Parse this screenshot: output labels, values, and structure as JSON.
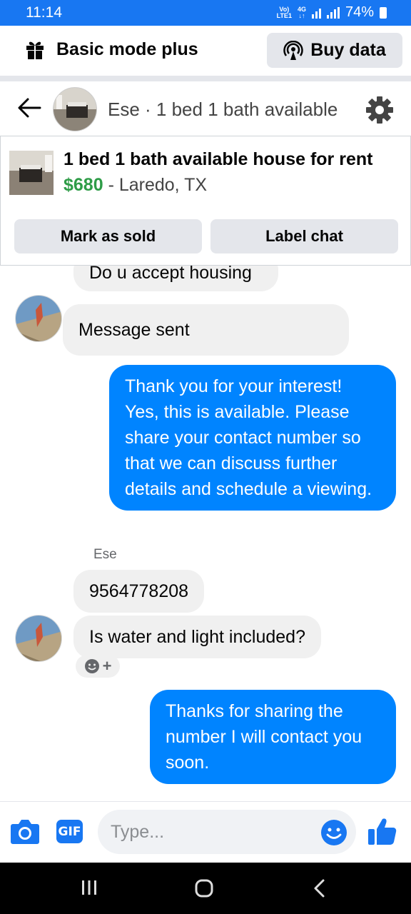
{
  "status_bar": {
    "time": "11:14",
    "network_top": "Vo)",
    "network_bottom": "LTE1",
    "network_type": "4G",
    "battery": "74%"
  },
  "mode_bar": {
    "title": "Basic mode plus",
    "buy_data": "Buy data"
  },
  "chat_header": {
    "title": "Ese · 1 bed 1 bath available"
  },
  "listing": {
    "title": "1 bed 1 bath available house for rent",
    "price": "$680",
    "location": " - Laredo, TX",
    "mark_sold": "Mark as sold",
    "label_chat": "Label chat"
  },
  "messages": {
    "m1": "Do u accept housing",
    "m2": "Message sent",
    "m3": "Thank you for your interest! Yes, this is available. Please share your contact number so that we can discuss further details and schedule a viewing.",
    "sender": "Ese",
    "m4": "9564778208",
    "m5": "Is water and light included?",
    "reaction_plus": "+",
    "m6": "Thanks for sharing the number I will contact you soon."
  },
  "composer": {
    "gif_label": "GIF",
    "placeholder": "Type..."
  },
  "colors": {
    "brand_blue": "#1877f2",
    "outgoing_bubble": "#0084ff",
    "incoming_bubble": "#f0f0f0",
    "price_green": "#2e9c47"
  },
  "icons": [
    "gift-icon",
    "broadcast-icon",
    "back-arrow-icon",
    "gear-icon",
    "camera-icon",
    "gif-icon",
    "emoji-icon",
    "thumbs-up-icon",
    "recents-icon",
    "home-icon",
    "back-nav-icon"
  ]
}
